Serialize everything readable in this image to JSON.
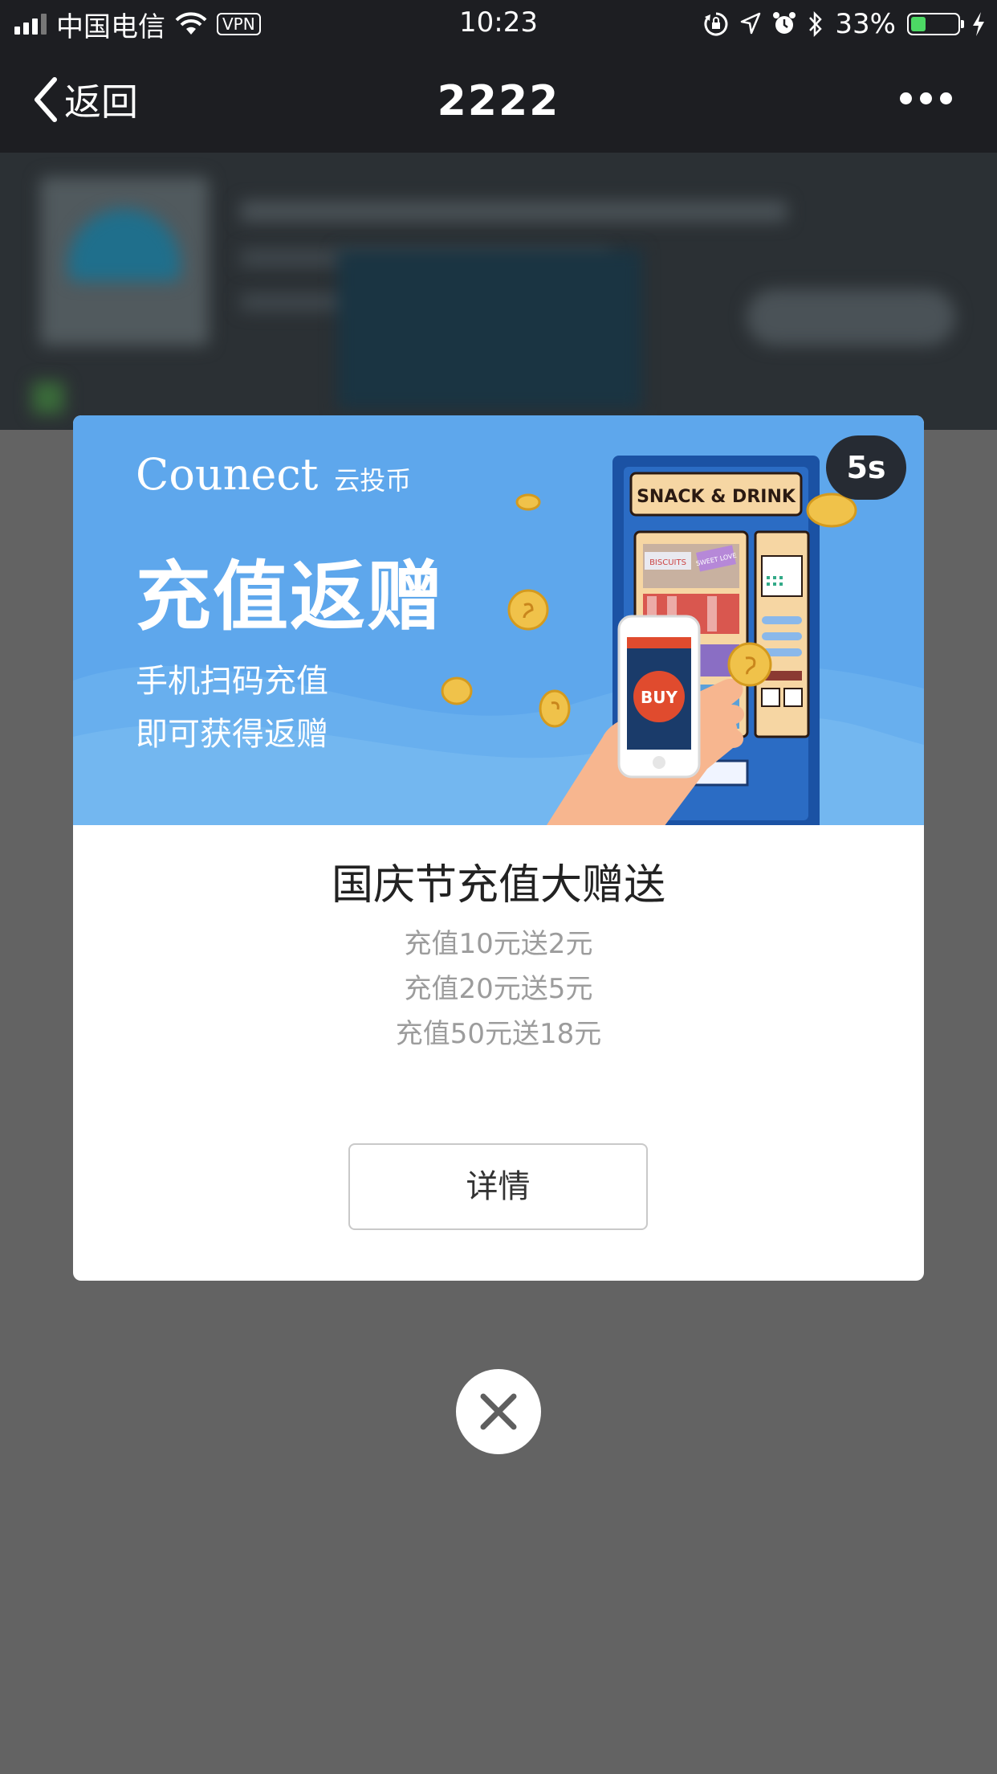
{
  "status_bar": {
    "carrier": "中国电信",
    "vpn": "VPN",
    "time": "10:23",
    "battery_percent": "33%",
    "battery_level": 0.33,
    "battery_color": "#4cd964"
  },
  "nav": {
    "back_label": "返回",
    "title": "2222"
  },
  "modal": {
    "countdown": "5s",
    "banner": {
      "logo_brand": "Counect",
      "logo_cn": "云投币",
      "headline": "充值返赠",
      "sub_line_1": "手机扫码充值",
      "sub_line_2": "即可获得返赠",
      "machine_sign": "SNACK & DRINK",
      "buy_label": "BUY",
      "biscuits_label": "BISCUITS",
      "sweet_label": "SWEET LOVE"
    },
    "promo_title": "国庆节充值大赠送",
    "promo_lines": [
      "充值10元送2元",
      "充值20元送5元",
      "充值50元送18元"
    ],
    "details_button": "详情"
  },
  "icons": [
    "signal-icon",
    "wifi-icon",
    "lock-rotation-icon",
    "location-icon",
    "alarm-icon",
    "bluetooth-icon",
    "battery-icon",
    "charging-icon",
    "back-chevron-icon",
    "more-icon",
    "close-icon"
  ],
  "colors": {
    "nav_bg": "#1d1e22",
    "overlay_bg": "#636363",
    "banner_bg": "#5ea7ec",
    "timer_bg": "#262b33"
  }
}
